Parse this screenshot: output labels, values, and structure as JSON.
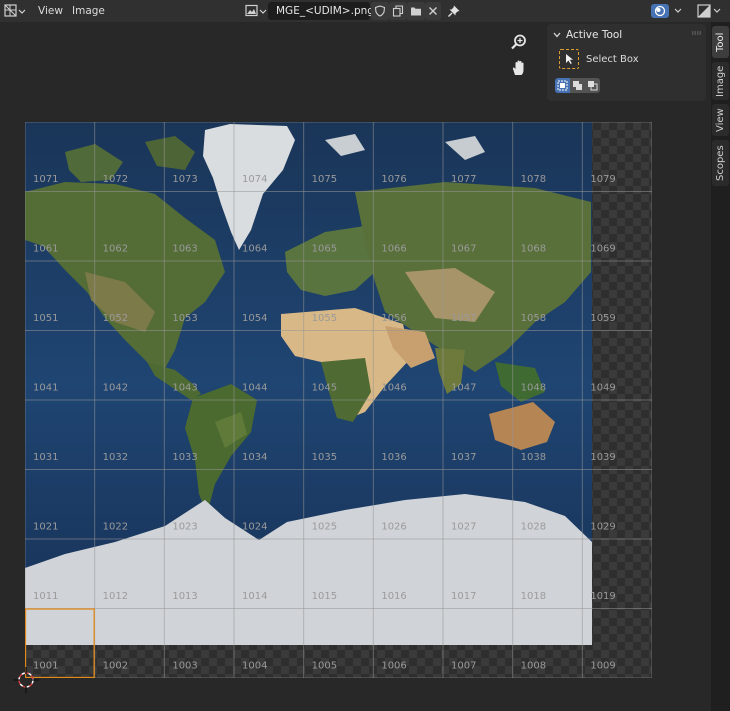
{
  "header": {
    "editor_type_icon": "uv-image-editor-icon",
    "menu": [
      "View",
      "Image"
    ],
    "image_name": "MGE_<UDIM>.png",
    "image_icons": [
      "shield-icon",
      "duplicate-icon",
      "folder-icon",
      "close-icon"
    ],
    "pin_icon": "pin-icon",
    "overlay_icon": "overlay-icon",
    "display_icon": "display-channels-icon"
  },
  "tool_panel": {
    "title": "Active Tool",
    "tool_name": "Select Box",
    "modes": [
      "select-new-icon",
      "select-extend-icon",
      "select-subtract-icon"
    ]
  },
  "side_tabs": [
    {
      "label": "Tool",
      "active": true
    },
    {
      "label": "Image",
      "active": false
    },
    {
      "label": "View",
      "active": false
    },
    {
      "label": "Scopes",
      "active": false
    }
  ],
  "udim_tiles": [
    [
      "1071",
      "1072",
      "1073",
      "1074",
      "1075",
      "1076",
      "1077",
      "1078",
      "1079"
    ],
    [
      "1061",
      "1062",
      "1063",
      "1064",
      "1065",
      "1066",
      "1067",
      "1068",
      "1069"
    ],
    [
      "1051",
      "1052",
      "1053",
      "1054",
      "1055",
      "1056",
      "1057",
      "1058",
      "1059"
    ],
    [
      "1041",
      "1042",
      "1043",
      "1044",
      "1045",
      "1046",
      "1047",
      "1048",
      "1049"
    ],
    [
      "1031",
      "1032",
      "1033",
      "1034",
      "1035",
      "1036",
      "1037",
      "1038",
      "1039"
    ],
    [
      "1021",
      "1022",
      "1023",
      "1024",
      "1025",
      "1026",
      "1027",
      "1028",
      "1029"
    ],
    [
      "1011",
      "1012",
      "1013",
      "1014",
      "1015",
      "1016",
      "1017",
      "1018",
      "1019"
    ],
    [
      "1001",
      "1002",
      "1003",
      "1004",
      "1005",
      "1006",
      "1007",
      "1008",
      "1009"
    ]
  ],
  "active_tile": "1001",
  "colors": {
    "ocean": "#1d3f66",
    "ice": "#d0d4d8",
    "land": "#4f6a36",
    "desert": "#c9a877",
    "active_tile_border": "#e08a1e"
  }
}
